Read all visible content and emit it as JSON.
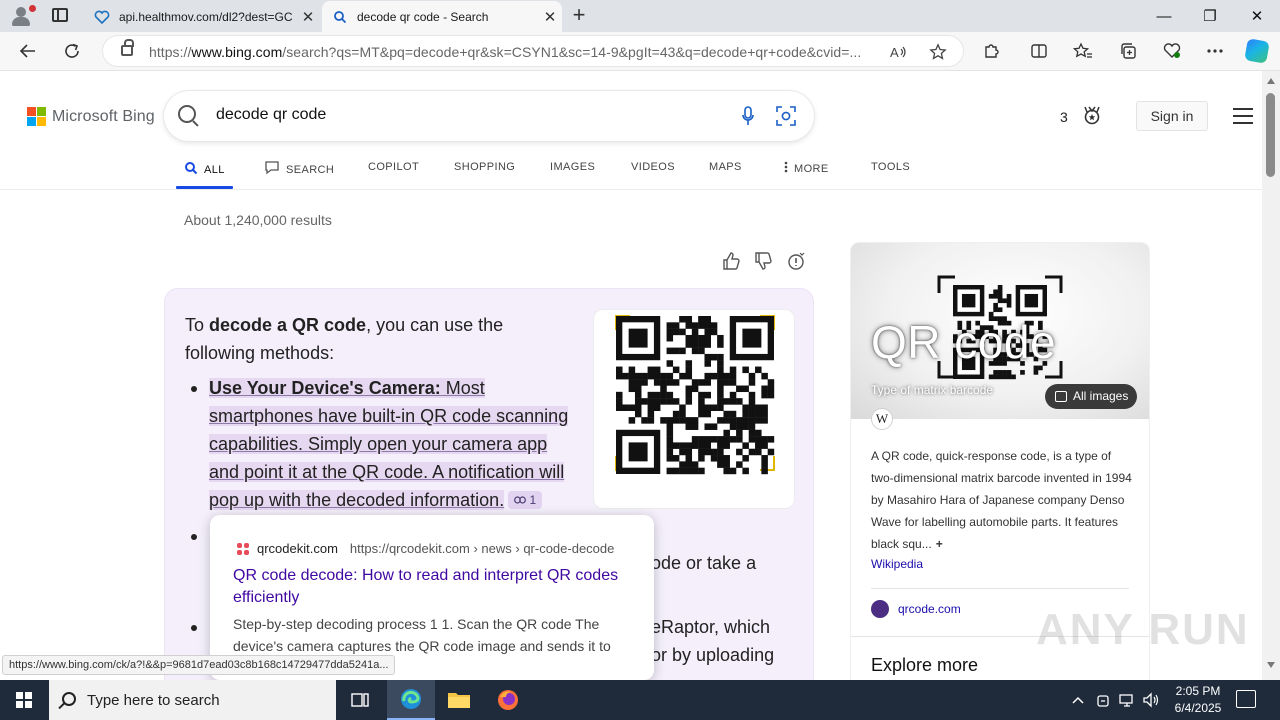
{
  "browser": {
    "tabs": [
      {
        "title": "api.healthmov.com/dl2?dest=GC",
        "close": "✕",
        "active": false
      },
      {
        "title": "decode qr code - Search",
        "close": "✕",
        "active": true
      }
    ],
    "new_tab": "+",
    "window_controls": {
      "minimize": "—",
      "restore": "❐",
      "close": "✕"
    },
    "url_prefix": "https://",
    "url_host": "www.bing.com",
    "url_rest": "/search?qs=MT&pq=decode+qr&sk=CSYN1&sc=14-9&pgIt=43&q=decode+qr+code&cvid=..."
  },
  "bing": {
    "logo_text": "Microsoft Bing",
    "logo_colors": [
      "#f25022",
      "#7fba00",
      "#00a4ef",
      "#ffb900"
    ],
    "query": "decode qr code",
    "rewards_count": "3",
    "sign_in": "Sign in",
    "nav_tabs": [
      {
        "label": "ALL",
        "icon": "search-icon"
      },
      {
        "label": "SEARCH",
        "icon": "chat-icon"
      },
      {
        "label": "COPILOT",
        "icon": ""
      },
      {
        "label": "SHOPPING",
        "icon": ""
      },
      {
        "label": "IMAGES",
        "icon": ""
      },
      {
        "label": "VIDEOS",
        "icon": ""
      },
      {
        "label": "MAPS",
        "icon": ""
      },
      {
        "label": "MORE",
        "icon": "more-vertical-icon"
      },
      {
        "label": "TOOLS",
        "icon": ""
      }
    ],
    "result_count": "About 1,240,000 results"
  },
  "answer": {
    "intro_prefix": "To ",
    "intro_bold": "decode a QR code",
    "intro_suffix": ", you can use the following methods:",
    "bullet1_bold": "Use Your Device's Camera:",
    "bullet1_text": " Most smartphones have built-in QR code scanning capabilities. Simply open your camera app and point it at the QR code. A notification will pop up with the decoded information.",
    "bullet1_cite": "1",
    "bullet2_fragment": "ode or take a",
    "bullet3_fragment_line1": "eRaptor, which",
    "bullet3_fragment_line2": "or by uploading"
  },
  "popup": {
    "site_name": "qrcodekit.com",
    "breadcrumb": "https://qrcodekit.com › news › qr-code-decode",
    "title": "QR code decode: How to read and interpret QR codes efficiently",
    "snippet": "Step-by-step decoding process 1 1. Scan the QR code The device's camera captures the QR code image and sends it to th..."
  },
  "status_link": "https://www.bing.com/ck/a?!&&p=9681d7ead03c8b168c14729477dda5241a...",
  "knowledge_panel": {
    "title": "QR code",
    "subtitle": "Type of matrix barcode",
    "all_images": "All images",
    "wiki_badge": "W",
    "description": "A QR code, quick-response code, is a type of two-dimensional matrix barcode invented in 1994 by Masahiro Hara of Japanese company Denso Wave for labelling automobile parts. It features black squ...",
    "more": "+",
    "wikipedia_link": "Wikipedia",
    "site_link": "qrcode.com",
    "explore_more": "Explore more"
  },
  "watermark": "ANY RUN",
  "taskbar": {
    "search_placeholder": "Type here to search",
    "time": "2:05 PM",
    "date": "6/4/2025"
  }
}
